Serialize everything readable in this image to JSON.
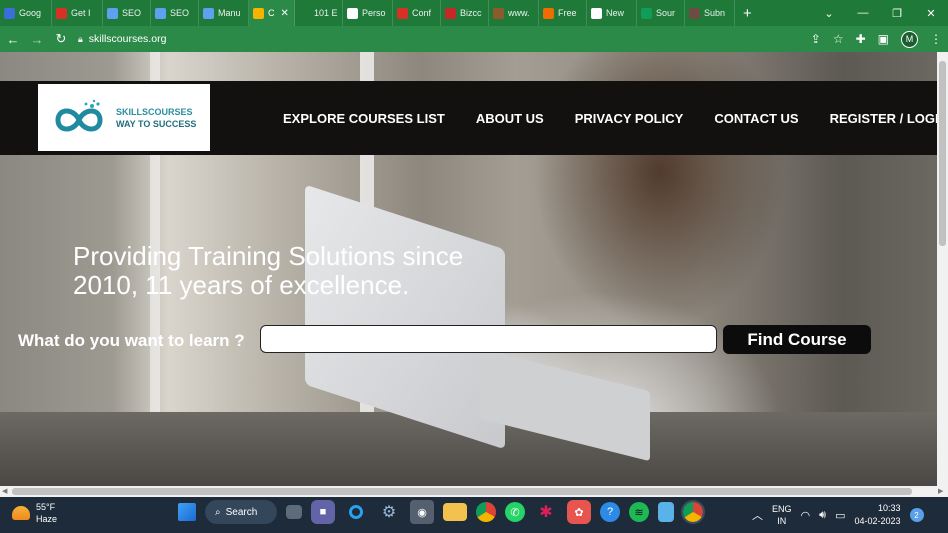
{
  "browser": {
    "tabs": [
      {
        "label": "Goog",
        "color": "#3a6fd8"
      },
      {
        "label": "Get I",
        "color": "#d93025"
      },
      {
        "label": "SEO",
        "color": "#5ea1f0"
      },
      {
        "label": "SEO",
        "color": "#5ea1f0"
      },
      {
        "label": "Manu",
        "color": "#5ea1f0"
      },
      {
        "label": "C",
        "color": "#f4b400",
        "active": true
      },
      {
        "label": "101 E",
        "color": "#1f7a3a"
      },
      {
        "label": "Perso",
        "color": "#ffffff"
      },
      {
        "label": "Conf",
        "color": "#d93025"
      },
      {
        "label": "Bizcc",
        "color": "#c62828"
      },
      {
        "label": "www.",
        "color": "#8d5a2b"
      },
      {
        "label": "Free",
        "color": "#ef6c00"
      },
      {
        "label": "New",
        "color": "#ffffff"
      },
      {
        "label": "Sour",
        "color": "#0f9d58"
      },
      {
        "label": "Subn",
        "color": "#6d4c41"
      }
    ],
    "url": "skillscourses.org",
    "profile_initial": "M"
  },
  "site": {
    "logo": {
      "line1": "SKILLSCOURSES",
      "line2": "WAY TO SUCCESS"
    },
    "nav": [
      "EXPLORE COURSES LIST",
      "ABOUT US",
      "PRIVACY POLICY",
      "CONTACT US",
      "REGISTER / LOGIN"
    ],
    "headline": "Providing Training Solutions since 2010, 11 years of excellence.",
    "search": {
      "label": "What do you want to learn ?",
      "value": "",
      "button": "Find Course"
    }
  },
  "taskbar": {
    "weather": {
      "temp": "55°F",
      "condition": "Haze"
    },
    "search_label": "Search",
    "lang": {
      "line1": "ENG",
      "line2": "IN"
    },
    "time": "10:33",
    "date": "04-02-2023",
    "notification_count": "2"
  }
}
